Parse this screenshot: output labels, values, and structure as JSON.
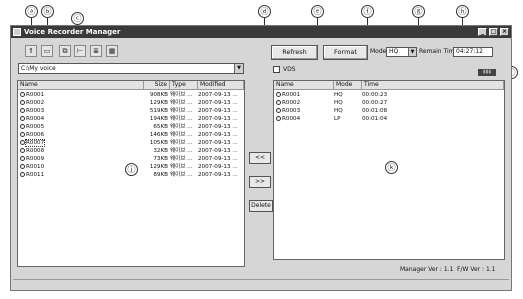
{
  "callouts": {
    "a": "ⓐ",
    "b": "ⓑ",
    "c": "ⓒ",
    "d": "ⓓ",
    "e": "ⓔ",
    "f": "ⓕ",
    "g": "ⓖ",
    "h": "ⓗ",
    "i": "ⓘ",
    "j": "ⓙ",
    "k": "ⓚ",
    "l": "ⓛ",
    "m": "ⓜ",
    "n": "ⓝ"
  },
  "window": {
    "title": "Voice Recorder Manager",
    "min": "_",
    "max": "□",
    "close": "×"
  },
  "toolbar": {
    "icons": [
      "folder-up-icon",
      "folder-icon",
      "copy-icon",
      "tree-icon",
      "list-icon",
      "grid-icon"
    ]
  },
  "path": {
    "value": "C:\\My voice",
    "arrow": "▼"
  },
  "vds": {
    "label": "VDS"
  },
  "buttons": {
    "refresh": "Refresh",
    "format": "Format",
    "copy_left": "<<",
    "copy_right": ">>",
    "delete": "Delete"
  },
  "mode": {
    "label": "Mode",
    "value": "HQ",
    "arrow": "▼"
  },
  "remain": {
    "label": "Remain Time",
    "value": "04:27:12"
  },
  "battery": {
    "label": "▮▮▮"
  },
  "pc_files": {
    "columns": [
      "Name",
      "Size",
      "Type",
      "Modified"
    ],
    "rows": [
      [
        "R0001",
        "908KB",
        "웨이브 ...",
        "2007-09-13 ..."
      ],
      [
        "R0002",
        "129KB",
        "웨이브 ...",
        "2007-09-13 ..."
      ],
      [
        "R0003",
        "519KB",
        "웨이브 ...",
        "2007-09-13 ..."
      ],
      [
        "R0004",
        "194KB",
        "웨이브 ...",
        "2007-09-13 ..."
      ],
      [
        "R0005",
        "65KB",
        "웨이브 ...",
        "2007-09-13 ..."
      ],
      [
        "R0006",
        "146KB",
        "웨이브 ...",
        "2007-09-13 ..."
      ],
      [
        "R0007",
        "105KB",
        "웨이브 ...",
        "2007-09-13 ..."
      ],
      [
        "R0008",
        "32KB",
        "웨이브 ...",
        "2007-09-13 ..."
      ],
      [
        "R0009",
        "73KB",
        "웨이브 ...",
        "2007-09-13 ..."
      ],
      [
        "R0010",
        "129KB",
        "웨이브 ...",
        "2007-09-13 ..."
      ],
      [
        "R0011",
        "89KB",
        "웨이브 ...",
        "2007-09-13 ..."
      ]
    ]
  },
  "device_files": {
    "columns": [
      "Name",
      "Mode",
      "Time"
    ],
    "rows": [
      [
        "R0001",
        "HQ",
        "00:00:23"
      ],
      [
        "R0002",
        "HQ",
        "00:00:27"
      ],
      [
        "R0003",
        "HQ",
        "00:01:08"
      ],
      [
        "R0004",
        "LP",
        "00:01:04"
      ]
    ]
  },
  "status": {
    "manager_ver": "Manager Ver : 1.1",
    "fw_ver": "F/W Ver : 1.1"
  }
}
